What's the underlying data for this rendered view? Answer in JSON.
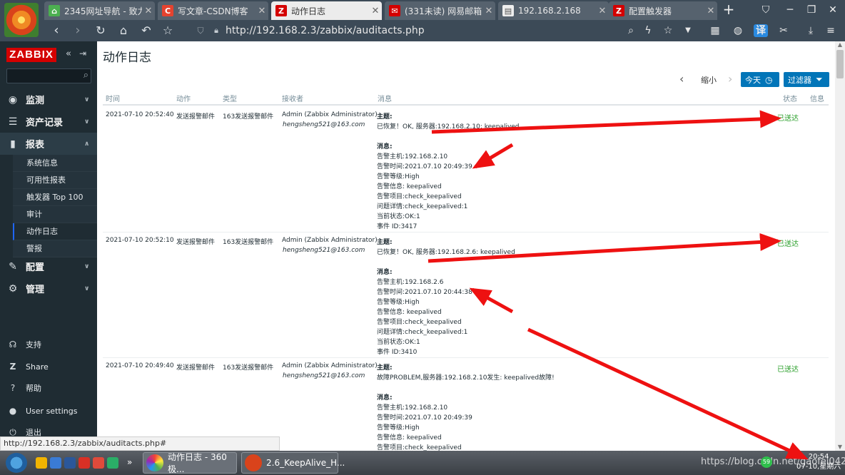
{
  "browser": {
    "tabs": [
      {
        "title": "2345网址导航 - 致力",
        "icon": "home-icon",
        "color": "#4caf50"
      },
      {
        "title": "写文章-CSDN博客",
        "icon": "csdn-icon",
        "color": "#e5432f",
        "glyph": "C"
      },
      {
        "title": "动作日志",
        "icon": "zabbix-icon",
        "color": "#d40000",
        "glyph": "Z"
      },
      {
        "title": "(331未读) 网易邮箱",
        "icon": "netease-mail-icon",
        "color": "#d40000",
        "glyph": "✉"
      },
      {
        "title": "192.168.2.168",
        "icon": "page-icon",
        "color": "#eeeeee",
        "glyph": "▤"
      },
      {
        "title": "配置触发器",
        "icon": "zabbix-icon",
        "color": "#d40000",
        "glyph": "Z"
      }
    ],
    "url": "http://192.168.2.3/zabbix/auditacts.php",
    "status_url": "http://192.168.2.3/zabbix/auditacts.php#",
    "translate_label": "译"
  },
  "sidebar": {
    "logo": "ZABBIX",
    "menu": [
      {
        "label": "监测",
        "icon": "eye-icon",
        "glyph": "◉"
      },
      {
        "label": "资产记录",
        "icon": "list-icon",
        "glyph": "☰"
      },
      {
        "label": "报表",
        "icon": "chart-icon",
        "glyph": "▮"
      }
    ],
    "submenu": [
      "系统信息",
      "可用性报表",
      "触发器 Top 100",
      "审计",
      "动作日志",
      "警报"
    ],
    "menu2": [
      {
        "label": "配置",
        "icon": "wrench-icon",
        "glyph": "🔧"
      },
      {
        "label": "管理",
        "icon": "gear-icon",
        "glyph": "⚙"
      }
    ],
    "lower": [
      {
        "label": "支持",
        "icon": "headset-icon",
        "glyph": "☊"
      },
      {
        "label": "Share",
        "icon": "share-icon",
        "glyph": "Z"
      },
      {
        "label": "帮助",
        "icon": "help-icon",
        "glyph": "?"
      },
      {
        "label": "User settings",
        "icon": "user-icon",
        "glyph": "●"
      },
      {
        "label": "退出",
        "icon": "power-icon",
        "glyph": "⏻"
      }
    ]
  },
  "page": {
    "title": "动作日志",
    "zoom_label": "缩小",
    "today_label": "今天",
    "filter_label": "过滤器"
  },
  "table": {
    "headers": {
      "time": "时间",
      "action": "动作",
      "type": "类型",
      "recipient": "接收者",
      "message": "消息",
      "status": "状态",
      "info": "信息"
    },
    "rows": [
      {
        "time": "2021-07-10 20:52:40",
        "action": "发送报警邮件",
        "type": "163发送报警邮件",
        "recipient_name": "Admin (Zabbix Administrator)",
        "recipient_email": "hengsheng521@163.com",
        "subject_label": "主题:",
        "subject": "已恢复！OK, 服务器:192.168.2.10: keepalived",
        "msg_label": "消息:",
        "lines": [
          "告警主机:192.168.2.10",
          "告警时间:2021.07.10 20:49:39",
          "告警等级:High",
          "告警信息: keepalived",
          "告警项目:check_keepalived",
          "问题详情:check_keepalived:1",
          "当前状态:OK:1",
          "事件 ID:3417"
        ],
        "status": "已送达"
      },
      {
        "time": "2021-07-10 20:52:10",
        "action": "发送报警邮件",
        "type": "163发送报警邮件",
        "recipient_name": "Admin (Zabbix Administrator)",
        "recipient_email": "hengsheng521@163.com",
        "subject_label": "主题:",
        "subject": "已恢复！OK, 服务器:192.168.2.6: keepalived",
        "msg_label": "消息:",
        "lines": [
          "告警主机:192.168.2.6",
          "告警时间:2021.07.10 20:44:38",
          "告警等级:High",
          "告警信息: keepalived",
          "告警项目:check_keepalived",
          "问题详情:check_keepalived:1",
          "当前状态:OK:1",
          "事件 ID:3410"
        ],
        "status": "已送达"
      },
      {
        "time": "2021-07-10 20:49:40",
        "action": "发送报警邮件",
        "type": "163发送报警邮件",
        "recipient_name": "Admin (Zabbix Administrator)",
        "recipient_email": "hengsheng521@163.com",
        "subject_label": "主题:",
        "subject": "故障PROBLEM,服务器:192.168.2.10发生: keepalived故障!",
        "msg_label": "消息:",
        "lines": [
          "告警主机:192.168.2.10",
          "告警时间:2021.07.10 20:49:39",
          "告警等级:High",
          "告警信息: keepalived",
          "告警项目:check_keepalived"
        ],
        "status": "已送达"
      }
    ]
  },
  "taskbar": {
    "tasks": [
      {
        "label": "动作日志 - 360极...",
        "icon": "360-browser-icon"
      },
      {
        "label": "2.6_KeepAlive_H...",
        "icon": "xmind-icon"
      }
    ],
    "watermark": "https://blog.csdn.net/gaofei0428",
    "badge": "59",
    "time": "20:54",
    "date": "07-10,星期六"
  },
  "colors": {
    "zabbix_red": "#d40000",
    "accent_blue": "#0275b8",
    "status_green": "#2ca02c",
    "annotation_red": "#ee1111"
  }
}
